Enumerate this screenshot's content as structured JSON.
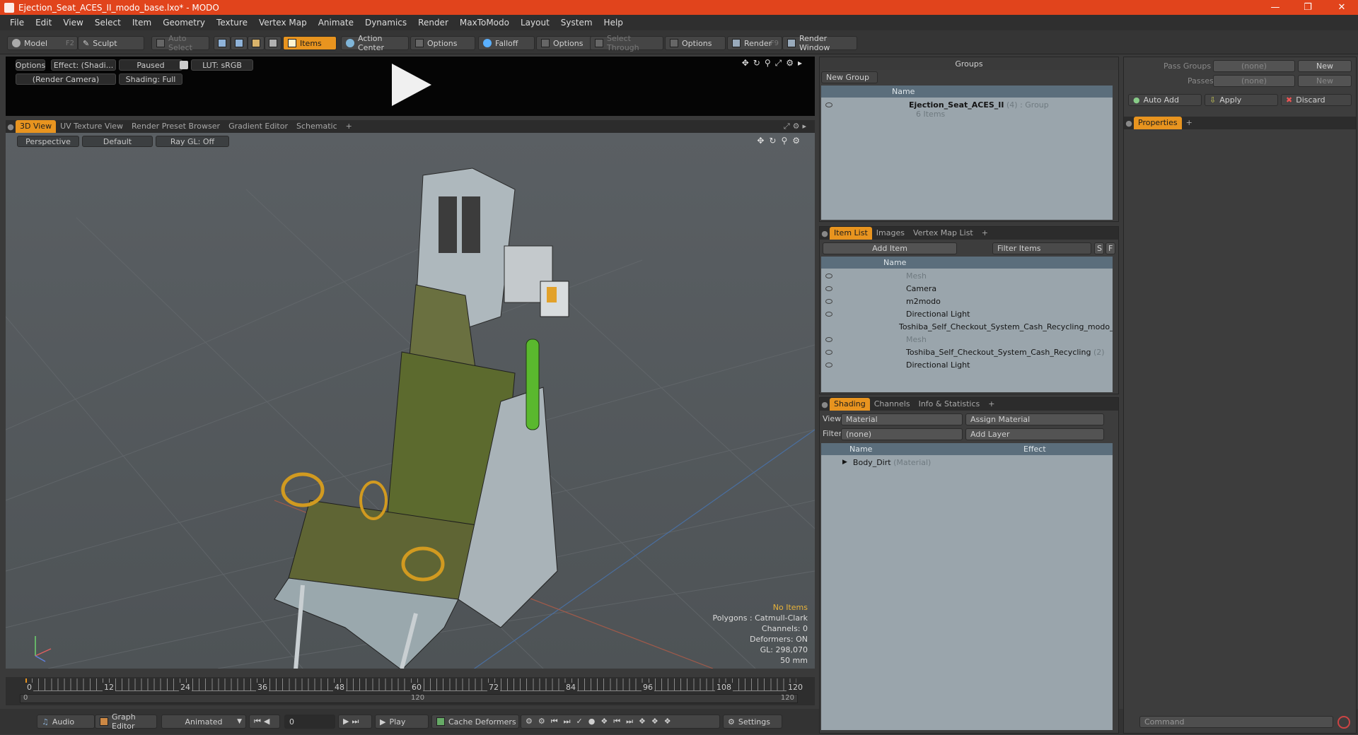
{
  "window": {
    "title": "Ejection_Seat_ACES_II_modo_base.lxo* - MODO"
  },
  "menu": [
    "File",
    "Edit",
    "View",
    "Select",
    "Item",
    "Geometry",
    "Texture",
    "Vertex Map",
    "Animate",
    "Dynamics",
    "Render",
    "MaxToModo",
    "Layout",
    "System",
    "Help"
  ],
  "toolbar": {
    "model": "Model",
    "model_key": "F2",
    "sculpt": "Sculpt",
    "auto_select": "Auto Select",
    "items": "Items",
    "action_center": "Action Center",
    "options1": "Options",
    "falloff": "Falloff",
    "options2": "Options",
    "select_through": "Select Through",
    "options3": "Options",
    "render": "Render",
    "render_key": "F9",
    "render_window": "Render Window"
  },
  "preview": {
    "options": "Options",
    "effect": "Effect: (Shadi...",
    "paused": "Paused",
    "lut": "LUT: sRGB",
    "camera": "(Render Camera)",
    "shading": "Shading: Full"
  },
  "viewport_tabs": [
    "3D View",
    "UV Texture View",
    "Render Preset Browser",
    "Gradient Editor",
    "Schematic",
    "+"
  ],
  "viewport": {
    "perspective": "Perspective",
    "default": "Default",
    "raygl": "Ray GL: Off"
  },
  "stats": {
    "no_items": "No Items",
    "polygons": "Polygons : Catmull-Clark",
    "channels": "Channels: 0",
    "deformers": "Deformers: ON",
    "gl": "GL: 298,070",
    "lens": "50 mm"
  },
  "timeline": {
    "ticks": [
      "0",
      "12",
      "24",
      "36",
      "48",
      "60",
      "72",
      "84",
      "96",
      "108",
      "120"
    ],
    "start": "0",
    "mid": "120",
    "end": "120"
  },
  "bottombar": {
    "audio": "Audio",
    "graph_editor": "Graph Editor",
    "animated": "Animated",
    "frame": "0",
    "play": "Play",
    "cache": "Cache Deformers",
    "settings": "Settings"
  },
  "groups": {
    "title": "Groups",
    "new_group": "New Group",
    "col_name": "Name",
    "item_name": "Ejection_Seat_ACES_II",
    "item_count": "(4)",
    "item_type": ": Group",
    "item_sub": "6 Items"
  },
  "item_list": {
    "tabs": [
      "Item List",
      "Images",
      "Vertex Map List",
      "+"
    ],
    "add_item": "Add Item",
    "filter": "Filter Items",
    "s": "S",
    "f": "F",
    "col_name": "Name",
    "rows": [
      {
        "label": "Mesh",
        "muted": true,
        "indent": 1
      },
      {
        "label": "Camera",
        "muted": false,
        "indent": 1
      },
      {
        "label": "m2modo",
        "muted": false,
        "indent": 1
      },
      {
        "label": "Directional Light",
        "muted": false,
        "indent": 1
      },
      {
        "label": "Toshiba_Self_Checkout_System_Cash_Recycling_modo_ba...",
        "muted": false,
        "indent": 0
      },
      {
        "label": "Mesh",
        "muted": true,
        "indent": 1
      },
      {
        "label": "Toshiba_Self_Checkout_System_Cash_Recycling",
        "muted": false,
        "indent": 1,
        "suffix": "(2)"
      },
      {
        "label": "Directional Light",
        "muted": false,
        "indent": 1
      }
    ]
  },
  "shading": {
    "tabs": [
      "Shading",
      "Channels",
      "Info & Statistics",
      "+"
    ],
    "view_label": "View",
    "view_value": "Material",
    "assign": "Assign Material",
    "filter_label": "Filter",
    "filter_value": "(none)",
    "add_layer": "Add Layer",
    "col_name": "Name",
    "col_effect": "Effect",
    "item": "Body_Dirt",
    "item_type": "(Material)"
  },
  "right": {
    "pass_groups": "Pass Groups",
    "passes": "Passes",
    "none1": "(none)",
    "none2": "(none)",
    "new1": "New",
    "new2": "New",
    "auto_add": "Auto Add",
    "apply": "Apply",
    "discard": "Discard",
    "properties": "Properties",
    "command": "Command"
  }
}
